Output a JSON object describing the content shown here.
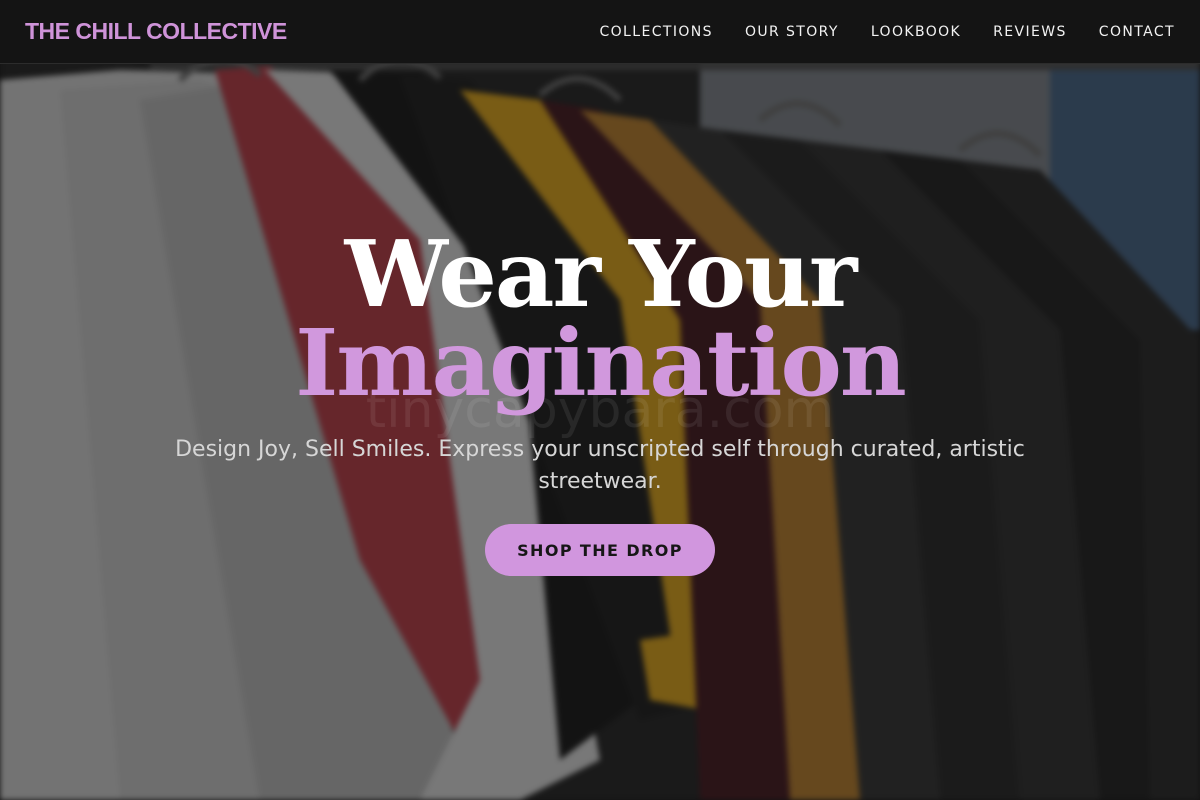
{
  "brand": {
    "name": "THE CHILL COLLECTIVE",
    "color": "#cf93d9"
  },
  "nav": {
    "items": [
      {
        "label": "COLLECTIONS"
      },
      {
        "label": "OUR STORY"
      },
      {
        "label": "LOOKBOOK"
      },
      {
        "label": "REVIEWS"
      },
      {
        "label": "CONTACT"
      }
    ]
  },
  "hero": {
    "headline_line1": "Wear Your",
    "headline_line2": "Imagination",
    "subheadline": "Design Joy, Sell Smiles. Express your unscripted self through curated, artistic streetwear.",
    "cta_label": "SHOP THE DROP",
    "watermark": "tinycapybara.com",
    "background": "clothing-rack-photo",
    "accent_color": "#d198dd"
  }
}
